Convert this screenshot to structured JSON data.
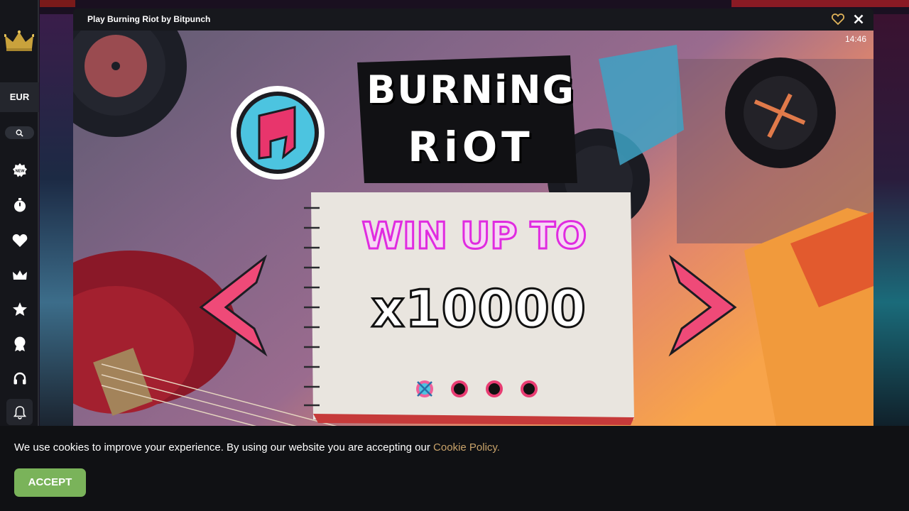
{
  "modal": {
    "title": "Play Burning Riot by Bitpunch",
    "clock": "14:46"
  },
  "sidebar": {
    "currency": "EUR",
    "items": [
      {
        "icon": "new-badge-icon"
      },
      {
        "icon": "stopwatch-icon"
      },
      {
        "icon": "heart-icon"
      },
      {
        "icon": "crown-icon"
      },
      {
        "icon": "star-icon"
      },
      {
        "icon": "trophy-icon"
      },
      {
        "icon": "headset-icon"
      },
      {
        "icon": "bell-icon"
      }
    ]
  },
  "game": {
    "logo_line1": "BURNiNG",
    "logo_line2": "RiOT",
    "win_label": "WIN UP TO",
    "multiplier": "x10000",
    "page_dots": 4,
    "current_page": 1
  },
  "cookie": {
    "text": "We use cookies to improve your experience. By using our website you are accepting our",
    "link": "Cookie Policy.",
    "accept": "ACCEPT"
  },
  "colors": {
    "accent_green": "#7ab35a",
    "link_gold": "#c9a36a",
    "game_pink": "#e02be0",
    "crown_gold": "#c9a23c"
  }
}
